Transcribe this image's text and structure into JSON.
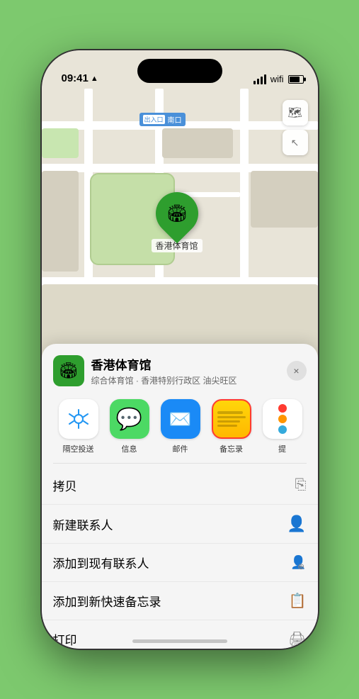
{
  "status_bar": {
    "time": "09:41",
    "location_arrow": "▲"
  },
  "map": {
    "entrance_label": "南口",
    "entrance_badge": "出入口",
    "location_name": "香港体育馆",
    "map_label_text": "香港体育馆"
  },
  "map_controls": {
    "layers_icon": "🗺",
    "compass_icon": "↑"
  },
  "venue_card": {
    "name": "香港体育馆",
    "subtitle": "综合体育馆 · 香港特别行政区 油尖旺区",
    "close_label": "×"
  },
  "share_items": [
    {
      "id": "airdrop",
      "label": "隔空投送",
      "selected": false
    },
    {
      "id": "messages",
      "label": "信息",
      "selected": false
    },
    {
      "id": "mail",
      "label": "邮件",
      "selected": false
    },
    {
      "id": "notes",
      "label": "备忘录",
      "selected": true
    },
    {
      "id": "more",
      "label": "提",
      "selected": false
    }
  ],
  "actions": [
    {
      "id": "copy",
      "label": "拷贝",
      "icon": "⎘"
    },
    {
      "id": "new-contact",
      "label": "新建联系人",
      "icon": "👤"
    },
    {
      "id": "add-existing",
      "label": "添加到现有联系人",
      "icon": "👤+"
    },
    {
      "id": "add-notes",
      "label": "添加到新快速备忘录",
      "icon": "📋"
    },
    {
      "id": "print",
      "label": "打印",
      "icon": "🖨"
    }
  ],
  "colors": {
    "green_bg": "#7dc96e",
    "pin_green": "#2e9e2e",
    "selected_border": "#ff3b30",
    "action_border": "#e8e8e8"
  }
}
